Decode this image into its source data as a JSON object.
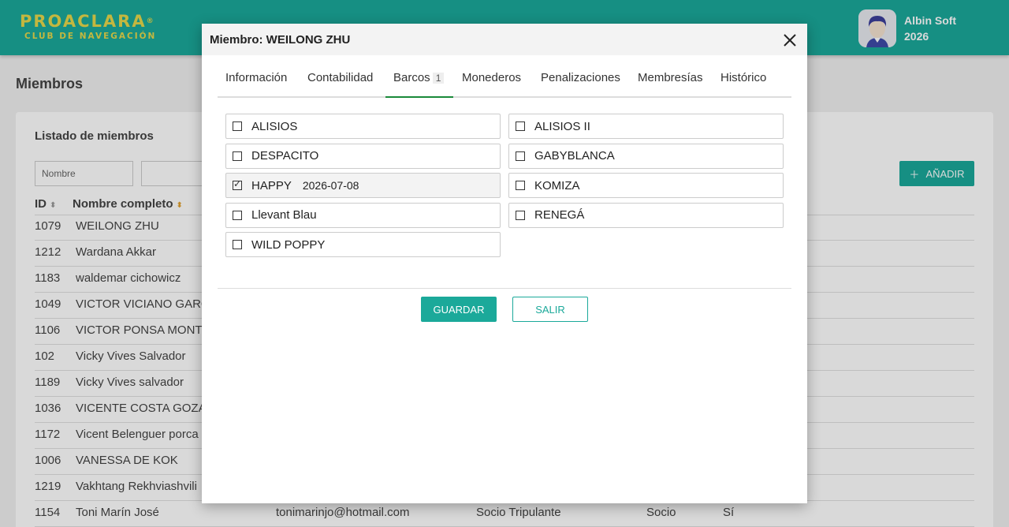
{
  "header": {
    "logo_main": "PROACLARA",
    "logo_reg": "®",
    "logo_sub": "CLUB DE NAVEGACIÓN",
    "user_line1": "Albin Soft",
    "user_line2": "2026"
  },
  "page": {
    "title": "Miembros",
    "list_title": "Listado de miembros",
    "filter_placeholder": "Nombre",
    "add_label": "AÑADIR",
    "columns": {
      "id": "ID",
      "name": "Nombre completo"
    },
    "rows": [
      {
        "id": "1079",
        "name": "WEILONG ZHU",
        "email": "",
        "type": "",
        "role": "",
        "flag": ""
      },
      {
        "id": "1212",
        "name": "Wardana Akkar",
        "email": "",
        "type": "",
        "role": "",
        "flag": ""
      },
      {
        "id": "1183",
        "name": "waldemar cichowicz",
        "email": "",
        "type": "",
        "role": "",
        "flag": ""
      },
      {
        "id": "1049",
        "name": "VICTOR VICIANO GARC",
        "email": "",
        "type": "",
        "role": "",
        "flag": ""
      },
      {
        "id": "1106",
        "name": "VICTOR PONSA MONTE",
        "email": "",
        "type": "",
        "role": "",
        "flag": ""
      },
      {
        "id": "102",
        "name": "Vicky Vives Salvador",
        "email": "",
        "type": "",
        "role": "",
        "flag": ""
      },
      {
        "id": "1189",
        "name": "Vicky Vives salvador",
        "email": "",
        "type": "",
        "role": "",
        "flag": ""
      },
      {
        "id": "1036",
        "name": "VICENTE COSTA GOZAL",
        "email": "",
        "type": "",
        "role": "",
        "flag": ""
      },
      {
        "id": "1172",
        "name": "Vicent Belenguer porca",
        "email": "",
        "type": "",
        "role": "",
        "flag": ""
      },
      {
        "id": "1006",
        "name": "VANESSA DE KOK",
        "email": "",
        "type": "",
        "role": "",
        "flag": ""
      },
      {
        "id": "1219",
        "name": "Vakhtang Rekhviashvili",
        "email": "",
        "type": "",
        "role": "",
        "flag": ""
      },
      {
        "id": "1154",
        "name": "Toni Marín José",
        "email": "tonimarinjo@hotmail.com",
        "type": "Socio Tripulante",
        "role": "Socio",
        "flag": "Sí"
      }
    ]
  },
  "modal": {
    "title": "Miembro: WEILONG ZHU",
    "tabs": [
      {
        "label": "Información"
      },
      {
        "label": "Contabilidad"
      },
      {
        "label": "Barcos",
        "badge": "1"
      },
      {
        "label": "Monederos"
      },
      {
        "label": "Penalizaciones"
      },
      {
        "label": "Membresías"
      },
      {
        "label": "Histórico"
      }
    ],
    "boats": [
      {
        "name": "ALISIOS",
        "checked": false,
        "date": ""
      },
      {
        "name": "ALISIOS II",
        "checked": false,
        "date": ""
      },
      {
        "name": "DESPACITO",
        "checked": false,
        "date": ""
      },
      {
        "name": "GABYBLANCA",
        "checked": false,
        "date": ""
      },
      {
        "name": "HAPPY",
        "checked": true,
        "date": "2026-07-08"
      },
      {
        "name": "KOMIZA",
        "checked": false,
        "date": ""
      },
      {
        "name": "Llevant Blau",
        "checked": false,
        "date": ""
      },
      {
        "name": "RENEGÁ",
        "checked": false,
        "date": ""
      },
      {
        "name": "WILD POPPY",
        "checked": false,
        "date": ""
      }
    ],
    "save_label": "GUARDAR",
    "exit_label": "SALIR"
  },
  "colors": {
    "brand": "#1ba99a",
    "logo": "#e6d84a",
    "active_tab": "#1a8a3a"
  }
}
